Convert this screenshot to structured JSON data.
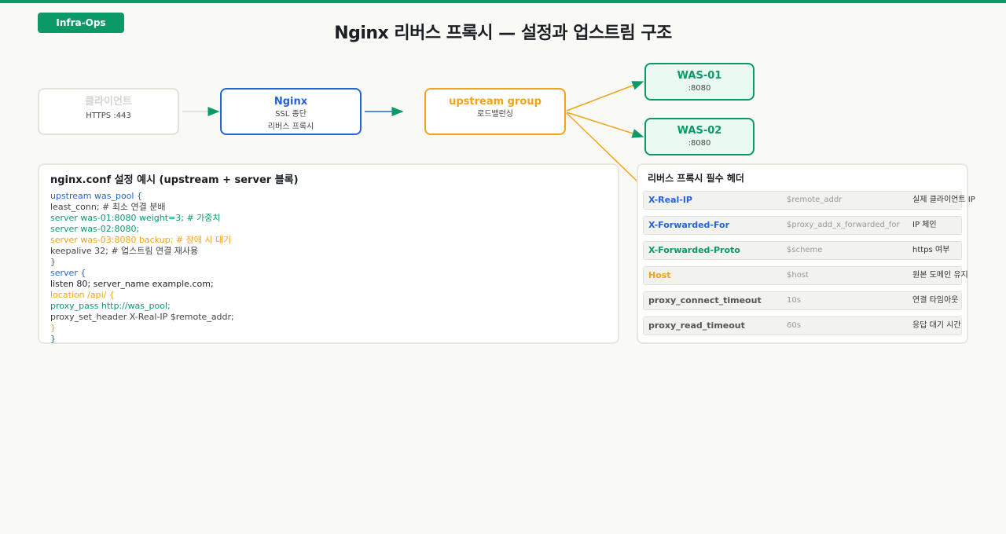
{
  "badge": "Infra-Ops",
  "title": "Nginx 리버스 프록시 — 설정과 업스트림 구조",
  "colors": {
    "accent": "#0b9968",
    "blue": "#2564d6",
    "orange": "#f3a21a",
    "gray": "#d4d4ce"
  },
  "nodes": {
    "client": {
      "title": "클라이언트",
      "sub": "HTTPS :443"
    },
    "nginx": {
      "title": "Nginx",
      "sub1": "SSL 종단",
      "sub2": "리버스 프록시"
    },
    "upstream": {
      "title": "upstream group",
      "sub": "로드밸런싱"
    },
    "was1": {
      "title": "WAS-01",
      "sub": ":8080"
    },
    "was2": {
      "title": "WAS-02",
      "sub": ":8080"
    }
  },
  "config": {
    "title": "nginx.conf 설정 예시 (upstream + server 블록)",
    "lines": [
      "upstream was_pool {",
      "least_conn; # 최소 연결 분배",
      "server was-01:8080 weight=3; # 가중치",
      "server was-02:8080;",
      "server was-03:8080 backup; # 장애 시 대기",
      "keepalive 32; # 업스트림 연결 재사용",
      "}",
      "server {",
      "listen 80; server_name example.com;",
      "location /api/ {",
      "proxy_pass http://was_pool;",
      "proxy_set_header X-Real-IP $remote_addr;",
      "}",
      "}"
    ]
  },
  "headers": {
    "title": "리버스 프록시 필수 헤더",
    "rows": [
      {
        "name": "X-Real-IP",
        "value": "$remote_addr",
        "desc": "실제 클라이언트 IP"
      },
      {
        "name": "X-Forwarded-For",
        "value": "$proxy_add_x_forwarded_for",
        "desc": "IP 체인"
      },
      {
        "name": "X-Forwarded-Proto",
        "value": "$scheme",
        "desc": "https 여부"
      },
      {
        "name": "Host",
        "value": "$host",
        "desc": "원본 도메인 유지"
      },
      {
        "name": "proxy_connect_timeout",
        "value": "10s",
        "desc": "연결 타임아웃"
      },
      {
        "name": "proxy_read_timeout",
        "value": "60s",
        "desc": "응답 대기 시간"
      }
    ]
  }
}
